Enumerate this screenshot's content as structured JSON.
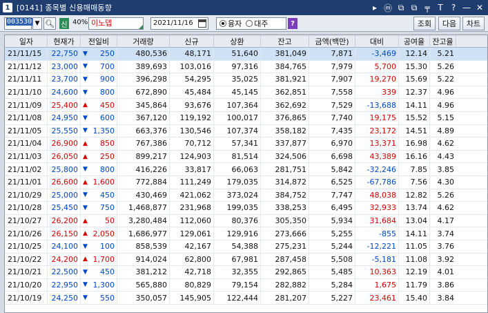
{
  "window": {
    "screen_no": "1",
    "title": "[0141] 종목별 신용매매동향",
    "buttons": [
      "▸",
      "ⓜ",
      "⧉",
      "⧉",
      "╤",
      "T",
      "?",
      "—",
      "✕"
    ]
  },
  "toolbar": {
    "code": "003530",
    "credit_badge": "신",
    "margin_ratio": "40%",
    "stock_name": "이노뎁",
    "date": "2021/11/16",
    "radio_options": [
      {
        "label": "융자",
        "selected": true
      },
      {
        "label": "대주",
        "selected": false
      }
    ],
    "help_label": "?",
    "query_button": "조회",
    "next_button": "다음",
    "chart_button": "차트"
  },
  "table": {
    "columns": [
      "일자",
      "현재가",
      "전일비",
      "거래량",
      "신규",
      "상환",
      "잔고",
      "금액(백만)",
      "대비",
      "공여율",
      "잔고율"
    ],
    "rows": [
      {
        "date": "21/11/15",
        "price": "22,750",
        "dir": "down",
        "chg": "250",
        "vol": "480,536",
        "new": "48,171",
        "repay": "51,640",
        "bal": "381,049",
        "amt": "7,871",
        "diff": "-3,469",
        "diff_dir": "down",
        "supply": "12.14",
        "ratio": "5.21",
        "selected": true
      },
      {
        "date": "21/11/12",
        "price": "23,000",
        "dir": "down",
        "chg": "700",
        "vol": "389,693",
        "new": "103,016",
        "repay": "97,316",
        "bal": "384,765",
        "amt": "7,979",
        "diff": "5,700",
        "diff_dir": "up",
        "supply": "15.30",
        "ratio": "5.26"
      },
      {
        "date": "21/11/11",
        "price": "23,700",
        "dir": "down",
        "chg": "900",
        "vol": "396,298",
        "new": "54,295",
        "repay": "35,025",
        "bal": "381,921",
        "amt": "7,907",
        "diff": "19,270",
        "diff_dir": "up",
        "supply": "15.69",
        "ratio": "5.22"
      },
      {
        "date": "21/11/10",
        "price": "24,600",
        "dir": "down",
        "chg": "800",
        "vol": "672,890",
        "new": "45,484",
        "repay": "45,145",
        "bal": "362,851",
        "amt": "7,558",
        "diff": "339",
        "diff_dir": "up",
        "supply": "12.37",
        "ratio": "4.96"
      },
      {
        "date": "21/11/09",
        "price": "25,400",
        "dir": "up",
        "chg": "450",
        "vol": "345,864",
        "new": "93,676",
        "repay": "107,364",
        "bal": "362,692",
        "amt": "7,529",
        "diff": "-13,688",
        "diff_dir": "down",
        "supply": "14.11",
        "ratio": "4.96"
      },
      {
        "date": "21/11/08",
        "price": "24,950",
        "dir": "down",
        "chg": "600",
        "vol": "367,120",
        "new": "119,192",
        "repay": "100,017",
        "bal": "376,865",
        "amt": "7,740",
        "diff": "19,175",
        "diff_dir": "up",
        "supply": "15.52",
        "ratio": "5.15"
      },
      {
        "date": "21/11/05",
        "price": "25,550",
        "dir": "down",
        "chg": "1,350",
        "vol": "663,376",
        "new": "130,546",
        "repay": "107,374",
        "bal": "358,182",
        "amt": "7,435",
        "diff": "23,172",
        "diff_dir": "up",
        "supply": "14.51",
        "ratio": "4.89"
      },
      {
        "date": "21/11/04",
        "price": "26,900",
        "dir": "up",
        "chg": "850",
        "vol": "767,386",
        "new": "70,712",
        "repay": "57,341",
        "bal": "337,877",
        "amt": "6,970",
        "diff": "13,371",
        "diff_dir": "up",
        "supply": "16.98",
        "ratio": "4.62"
      },
      {
        "date": "21/11/03",
        "price": "26,050",
        "dir": "up",
        "chg": "250",
        "vol": "899,217",
        "new": "124,903",
        "repay": "81,514",
        "bal": "324,506",
        "amt": "6,698",
        "diff": "43,389",
        "diff_dir": "up",
        "supply": "16.16",
        "ratio": "4.43"
      },
      {
        "date": "21/11/02",
        "price": "25,800",
        "dir": "down",
        "chg": "800",
        "vol": "416,226",
        "new": "33,817",
        "repay": "66,063",
        "bal": "281,751",
        "amt": "5,842",
        "diff": "-32,246",
        "diff_dir": "down",
        "supply": "7.85",
        "ratio": "3.85"
      },
      {
        "date": "21/11/01",
        "price": "26,600",
        "dir": "up",
        "chg": "1,600",
        "vol": "772,884",
        "new": "111,249",
        "repay": "179,035",
        "bal": "314,872",
        "amt": "6,525",
        "diff": "-67,786",
        "diff_dir": "down",
        "supply": "7.56",
        "ratio": "4.30"
      },
      {
        "date": "21/10/29",
        "price": "25,000",
        "dir": "down",
        "chg": "450",
        "vol": "430,469",
        "new": "421,062",
        "repay": "373,024",
        "bal": "384,752",
        "amt": "7,747",
        "diff": "48,038",
        "diff_dir": "up",
        "supply": "12.82",
        "ratio": "5.26"
      },
      {
        "date": "21/10/28",
        "price": "25,450",
        "dir": "down",
        "chg": "750",
        "vol": "1,468,877",
        "new": "231,968",
        "repay": "199,035",
        "bal": "338,253",
        "amt": "6,495",
        "diff": "32,933",
        "diff_dir": "up",
        "supply": "13.74",
        "ratio": "4.62"
      },
      {
        "date": "21/10/27",
        "price": "26,200",
        "dir": "up",
        "chg": "50",
        "vol": "3,280,484",
        "new": "112,060",
        "repay": "80,376",
        "bal": "305,350",
        "amt": "5,934",
        "diff": "31,684",
        "diff_dir": "up",
        "supply": "13.04",
        "ratio": "4.17"
      },
      {
        "date": "21/10/26",
        "price": "26,150",
        "dir": "up",
        "chg": "2,050",
        "vol": "1,686,977",
        "new": "129,061",
        "repay": "129,916",
        "bal": "273,666",
        "amt": "5,255",
        "diff": "-855",
        "diff_dir": "down",
        "supply": "14.11",
        "ratio": "3.74"
      },
      {
        "date": "21/10/25",
        "price": "24,100",
        "dir": "down",
        "chg": "100",
        "vol": "858,539",
        "new": "42,167",
        "repay": "54,388",
        "bal": "275,231",
        "amt": "5,244",
        "diff": "-12,221",
        "diff_dir": "down",
        "supply": "11.05",
        "ratio": "3.76"
      },
      {
        "date": "21/10/22",
        "price": "24,200",
        "dir": "up",
        "chg": "1,700",
        "vol": "914,024",
        "new": "62,800",
        "repay": "67,981",
        "bal": "287,458",
        "amt": "5,508",
        "diff": "-5,181",
        "diff_dir": "down",
        "supply": "11.08",
        "ratio": "3.92"
      },
      {
        "date": "21/10/21",
        "price": "22,500",
        "dir": "down",
        "chg": "450",
        "vol": "381,212",
        "new": "42,718",
        "repay": "32,355",
        "bal": "292,865",
        "amt": "5,485",
        "diff": "10,363",
        "diff_dir": "up",
        "supply": "12.19",
        "ratio": "4.01"
      },
      {
        "date": "21/10/20",
        "price": "22,950",
        "dir": "down",
        "chg": "1,300",
        "vol": "565,880",
        "new": "80,829",
        "repay": "79,154",
        "bal": "282,882",
        "amt": "5,284",
        "diff": "1,675",
        "diff_dir": "up",
        "supply": "11.79",
        "ratio": "3.86"
      },
      {
        "date": "21/10/19",
        "price": "24,250",
        "dir": "down",
        "chg": "550",
        "vol": "350,057",
        "new": "145,905",
        "repay": "122,444",
        "bal": "281,207",
        "amt": "5,227",
        "diff": "23,461",
        "diff_dir": "up",
        "supply": "15.40",
        "ratio": "3.84"
      }
    ]
  }
}
